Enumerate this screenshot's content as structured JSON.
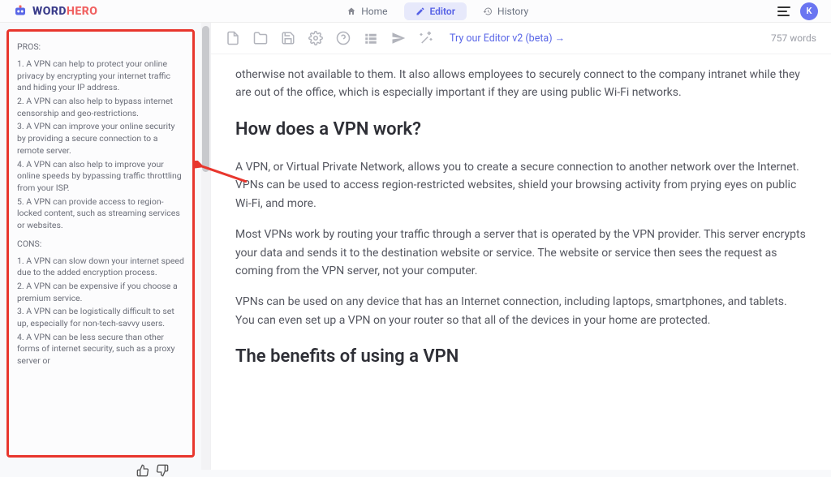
{
  "brand": {
    "word": "WORD",
    "hero": "HERO"
  },
  "nav": {
    "home": "Home",
    "editor": "Editor",
    "history": "History"
  },
  "avatar": "K",
  "sidebar": {
    "pros_heading": "PROS:",
    "pros": [
      "1. A VPN can help to protect your online privacy by encrypting your internet traffic and hiding your IP address.",
      "2. A VPN can also help to bypass internet censorship and geo-restrictions.",
      "3. A VPN can improve your online security by providing a secure connection to a remote server.",
      "4. A VPN can also help to improve your online speeds by bypassing traffic throttling from your ISP.",
      "5. A VPN can provide access to region-locked content, such as streaming services or websites."
    ],
    "cons_heading": "CONS:",
    "cons": [
      "1. A VPN can slow down your internet speed due to the added encryption process.",
      "2. A VPN can be expensive if you choose a premium service.",
      "3. A VPN can be logistically difficult to set up, especially for non-tech-savvy users.",
      "4. A VPN can be less secure than other forms of internet security, such as a proxy server or"
    ]
  },
  "toolbar": {
    "try_link": "Try our Editor v2 (beta) →",
    "word_count": "757 words"
  },
  "article": {
    "p0": "otherwise not available to them. It also allows employees to securely connect to the company intranet while they are out of the office, which is especially important if they are using public Wi-Fi networks.",
    "h1": "How does a VPN work?",
    "p1": "A VPN, or Virtual Private Network, allows you to create a secure connection to another network over the Internet. VPNs can be used to access region-restricted websites, shield your browsing activity from prying eyes on public Wi-Fi, and more.",
    "p2": "Most VPNs work by routing your traffic through a server that is operated by the VPN provider. This server encrypts your data and sends it to the destination website or service. The website or service then sees the request as coming from the VPN server, not your computer.",
    "p3": "VPNs can be used on any device that has an Internet connection, including laptops, smartphones, and tablets. You can even set up a VPN on your router so that all of the devices in your home are protected.",
    "h2": "The benefits of using a VPN"
  }
}
